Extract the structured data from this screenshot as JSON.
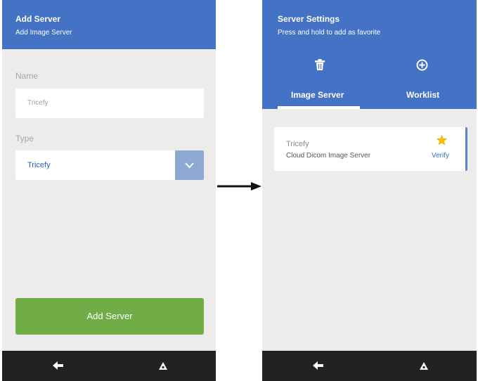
{
  "left_screen": {
    "header": {
      "title": "Add Server",
      "subtitle": "Add Image Server"
    },
    "name_field": {
      "label": "Name",
      "value": "Tricefy"
    },
    "type_field": {
      "label": "Type",
      "value": "Tricefy"
    },
    "add_button_label": "Add Server"
  },
  "right_screen": {
    "header": {
      "title": "Server Settings",
      "subtitle": "Press and hold to add as favorite"
    },
    "tabs": [
      {
        "label": "Image Server",
        "active": true
      },
      {
        "label": "Worklist",
        "active": false
      }
    ],
    "server_card": {
      "name": "Tricefy",
      "description": "Cloud Dicom Image Server",
      "action_label": "Verify",
      "favorite": true
    }
  },
  "icons": [
    "trash-icon",
    "add-circle-icon",
    "chevron-down-icon",
    "back-arrow-icon",
    "home-triangle-icon",
    "star-icon",
    "flow-arrow-icon"
  ],
  "colors": {
    "header_blue": "#4472c4",
    "add_button_green": "#70ad47",
    "star_yellow": "#ffc000",
    "nav_bar": "#222222"
  }
}
